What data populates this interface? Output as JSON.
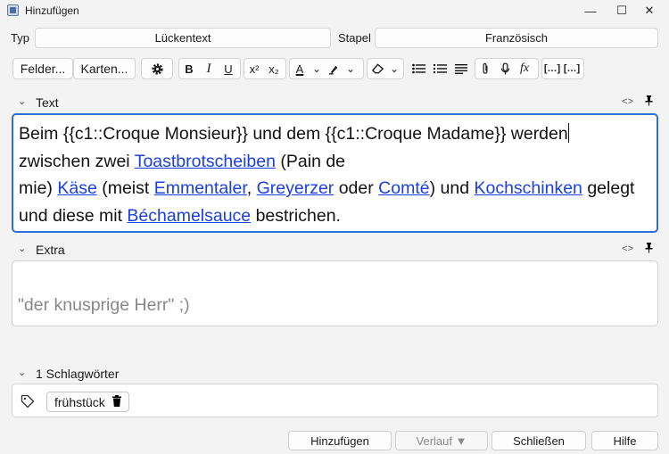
{
  "window": {
    "title": "Hinzufügen",
    "minimize": "—",
    "maximize": "☐",
    "close": "✕"
  },
  "header": {
    "type_label": "Typ",
    "type_value": "Lückentext",
    "deck_label": "Stapel",
    "deck_value": "Französisch"
  },
  "toolbar": {
    "fields_button": "Felder...",
    "cards_button": "Karten...",
    "bold": "B",
    "italic": "I",
    "underline": "U",
    "superscript": "x²",
    "subscript": "x₂",
    "text_color": "A",
    "dropdown": "⌄",
    "highlight": "✎",
    "eraser": "◇",
    "bullet_list": "☰",
    "numbered_list": "≡",
    "align": "≣",
    "attach": "⌁",
    "record": "🎙",
    "formula": "fx",
    "cloze_new": "[…]",
    "cloze_same": "[…]"
  },
  "fields": [
    {
      "name": "Text",
      "content": {
        "line1": "Beim {{c1::Croque Monsieur}} und dem {{c1::Croque Madame}} werden",
        "l2_pre": "zwischen zwei ",
        "l2_link": "Toastbrotscheiben",
        "l2_post": " (Pain de",
        "l3_pre": "mie) ",
        "l3_link1": "Käse",
        "l3_mid1": " (meist ",
        "l3_link2": "Emmentaler",
        "l3_mid2": ", ",
        "l3_link3": "Greyerzer",
        "l3_mid3": " oder ",
        "l3_link4": "Comté",
        "l3_mid4": ") und ",
        "l3_link5": "Kochschinken",
        "l3_post": " gelegt",
        "l4_pre": "und diese mit ",
        "l4_link": "Béchamelsauce",
        "l4_post": " bestrichen."
      }
    },
    {
      "name": "Extra",
      "content": "\"der knusprige Herr\" ;)"
    }
  ],
  "field_controls": {
    "html_toggle": "<>",
    "pin": "📌"
  },
  "tags": {
    "label": "1 Schlagwörter",
    "items": [
      "frühstück"
    ]
  },
  "buttons": {
    "add": "Hinzufügen",
    "history": "Verlauf ▼",
    "close": "Schließen",
    "help": "Hilfe"
  }
}
